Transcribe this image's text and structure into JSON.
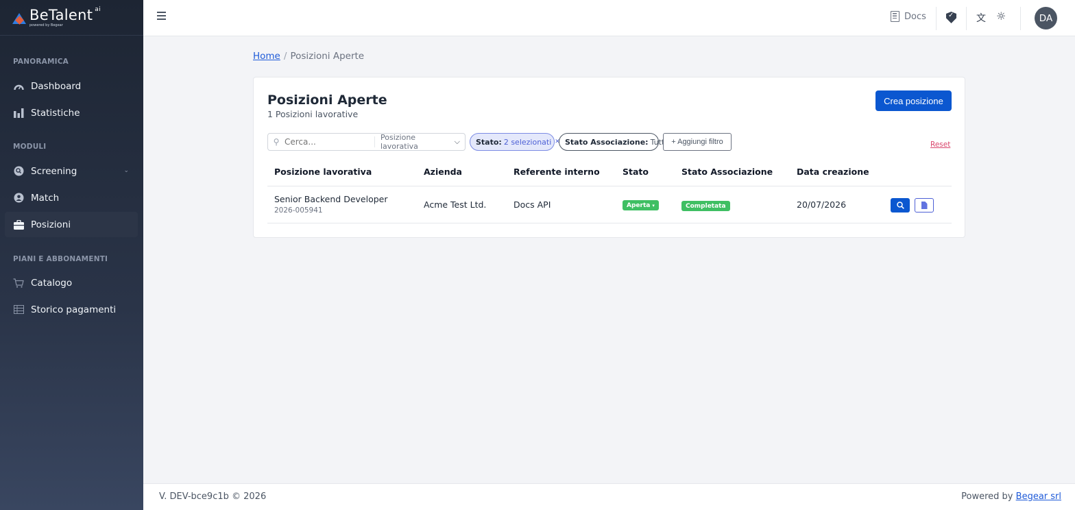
{
  "brand": {
    "name": "BeTalent",
    "superscript": "ai",
    "tagline": "powered by Begear"
  },
  "sidebar": {
    "sections": [
      {
        "label": "PANORAMICA",
        "items": [
          {
            "label": "Dashboard",
            "icon": "gauge-icon"
          },
          {
            "label": "Statistiche",
            "icon": "bar-chart-icon"
          }
        ]
      },
      {
        "label": "MODULI",
        "items": [
          {
            "label": "Screening",
            "icon": "screening-icon"
          },
          {
            "label": "Match",
            "icon": "user-circle-icon"
          },
          {
            "label": "Posizioni",
            "icon": "briefcase-icon",
            "active": true
          }
        ]
      },
      {
        "label": "PIANI E ABBONAMENTI",
        "items": [
          {
            "label": "Catalogo",
            "icon": "cart-icon"
          },
          {
            "label": "Storico pagamenti",
            "icon": "table-icon"
          }
        ]
      }
    ]
  },
  "topbar": {
    "docs_label": "Docs",
    "avatar_initials": "DA"
  },
  "breadcrumb": {
    "home": "Home",
    "separator": "/",
    "current": "Posizioni Aperte"
  },
  "page": {
    "title": "Posizioni Aperte",
    "subtitle": "1 Posizioni lavorative",
    "create_button": "Crea posizione"
  },
  "filters": {
    "search_placeholder": "Cerca...",
    "search_field": "Posizione lavorativa",
    "stato_label": "Stato:",
    "stato_value": "2 selezionati",
    "assoc_label": "Stato Associazione:",
    "assoc_value": "Tutti",
    "add_filter": "+ Aggiungi filtro",
    "reset": "Reset"
  },
  "table": {
    "columns": [
      "Posizione lavorativa",
      "Azienda",
      "Referente interno",
      "Stato",
      "Stato Associazione",
      "Data creazione"
    ],
    "rows": [
      {
        "title": "Senior Backend Developer",
        "code": "2026-005941",
        "company": "Acme Test Ltd.",
        "referent": "Docs API",
        "status": "Aperta",
        "association": "Completata",
        "created": "20/07/2026"
      }
    ]
  },
  "footer": {
    "version": "V. DEV-bce9c1b © 2026",
    "powered_prefix": "Powered by",
    "powered_link": "Begear srl"
  },
  "colors": {
    "primary": "#0b57d0",
    "success": "#3fbf63",
    "danger_link": "#d9446b",
    "sidebar_bg": "#1d2533"
  }
}
